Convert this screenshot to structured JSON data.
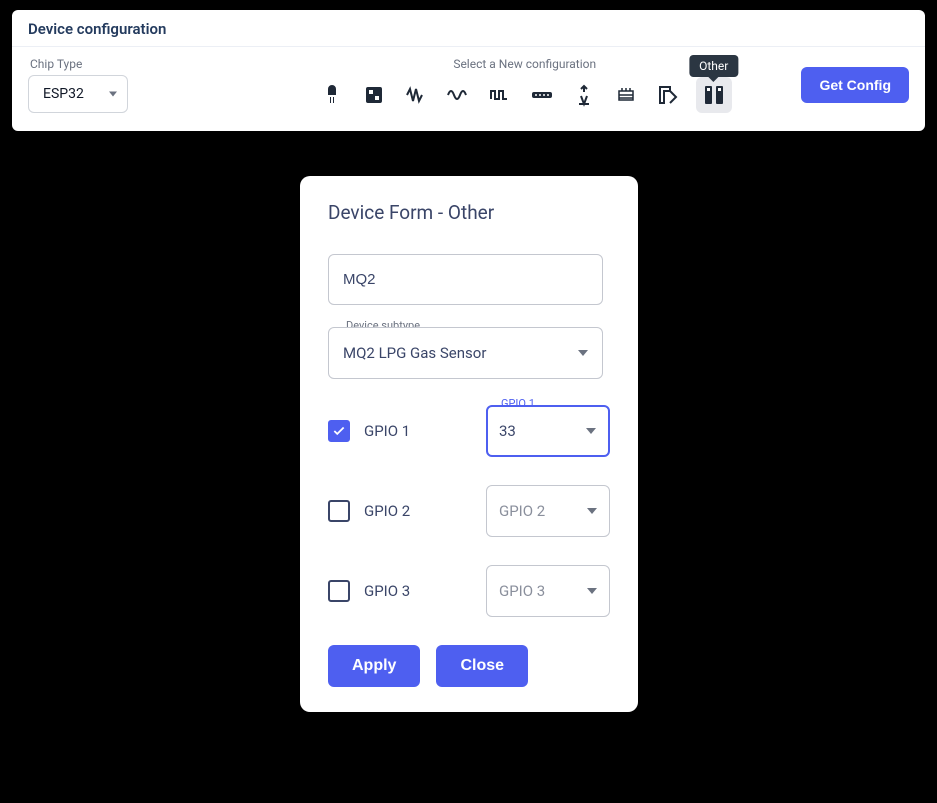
{
  "panel": {
    "title": "Device configuration",
    "chip_type_label": "Chip Type",
    "chip_type_value": "ESP32",
    "select_label": "Select a New configuration",
    "tooltip": "Other",
    "get_config": "Get Config"
  },
  "config_icons": [
    "led-icon",
    "relay-icon",
    "pwm-icon",
    "analog-icon",
    "digital-icon",
    "uart-icon",
    "spi-icon",
    "i2c-icon",
    "dimension-icon",
    "other-icon"
  ],
  "modal": {
    "title": "Device Form - Other",
    "name_value": "MQ2",
    "subtype_label": "Device subtype",
    "subtype_value": "MQ2 LPG Gas Sensor",
    "gpio_rows": [
      {
        "label": "GPIO 1",
        "checked": true,
        "legend": "GPIO 1",
        "value": "33"
      },
      {
        "label": "GPIO 2",
        "checked": false,
        "legend": "",
        "value": "GPIO 2"
      },
      {
        "label": "GPIO 3",
        "checked": false,
        "legend": "",
        "value": "GPIO 3"
      }
    ],
    "apply": "Apply",
    "close": "Close"
  }
}
